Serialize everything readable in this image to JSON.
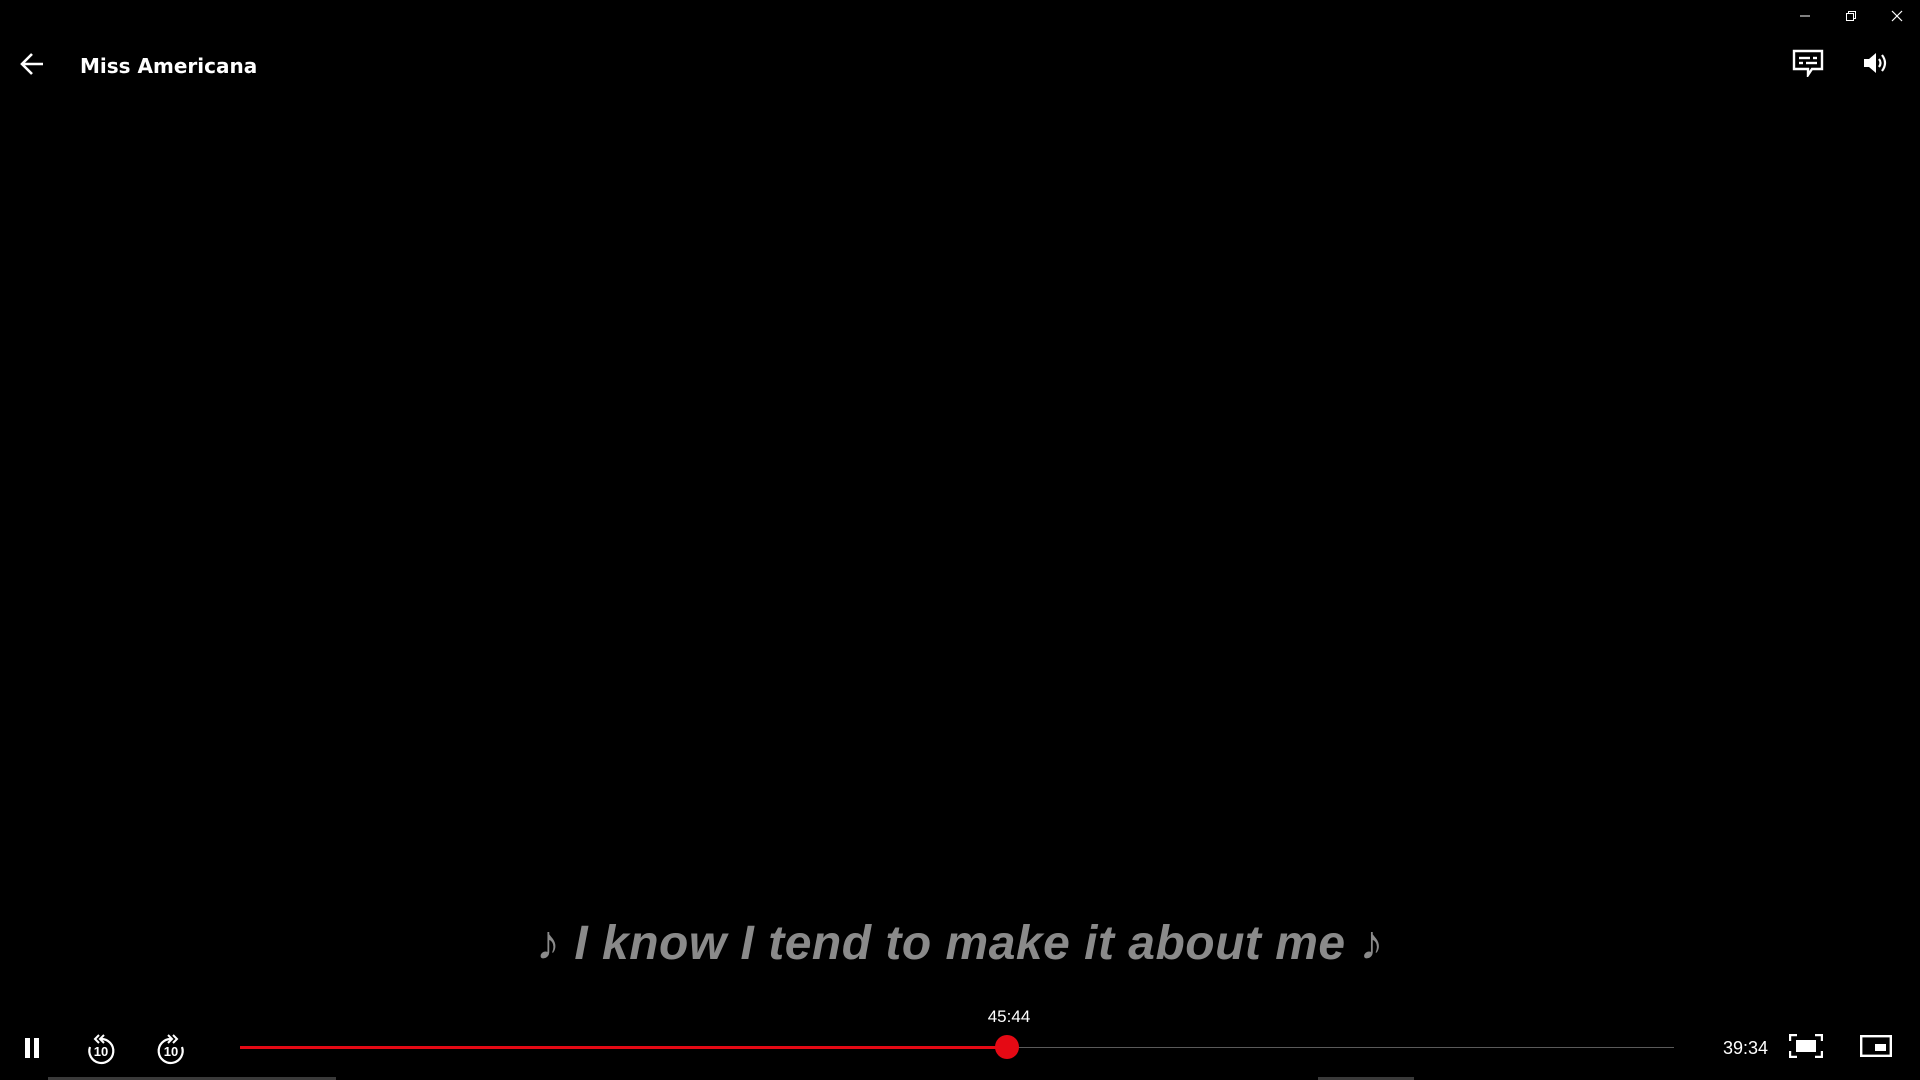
{
  "window": {
    "caption_buttons": [
      "minimize-icon",
      "restore-icon",
      "close-icon"
    ]
  },
  "header": {
    "title": "Miss Americana",
    "back_icon": "arrow-left-icon",
    "subtitles_icon": "subtitles-icon",
    "volume_icon": "volume-icon"
  },
  "subtitle": {
    "text": "♪ I know I tend to make it about me ♪"
  },
  "player": {
    "playback_state": "playing",
    "pause_icon": "pause-icon",
    "rewind_icon": "rewind-10-icon",
    "forward_icon": "forward-10-icon",
    "skip_seconds": "10",
    "hover_time": "45:44",
    "time_remaining": "39:34",
    "progress_fraction": 0.535,
    "accent_color": "#e50914",
    "fullscreen_icon": "fullscreen-icon",
    "pip_icon": "picture-in-picture-icon"
  }
}
